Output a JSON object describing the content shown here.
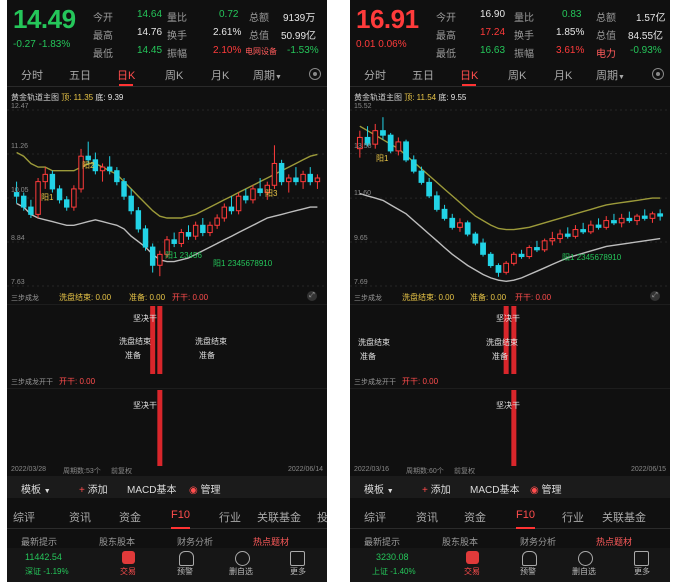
{
  "left": {
    "price": "14.49",
    "change": "-0.27",
    "change_pct": "-1.83%",
    "color_price": "#25c65a",
    "quote": [
      {
        "label": "今开",
        "value": "14.64",
        "label2": "量比",
        "value2": "0.72",
        "label3": "总额",
        "value3": "9139万"
      },
      {
        "label": "最高",
        "value": "14.76",
        "label2": "换手",
        "value2": "2.61%",
        "label3": "总值",
        "value3": "50.99亿"
      },
      {
        "label": "最低",
        "value": "14.45",
        "label2": "振幅",
        "value2": "2.10%",
        "label3": "电网设备",
        "value3": "-1.53%"
      }
    ],
    "period_tabs": [
      "分时",
      "五日",
      "日K",
      "周K",
      "月K",
      "周期"
    ],
    "active_tab": "日K",
    "indicator_name": "黄金轨道主图",
    "indicator_top": "顶: 11.35",
    "indicator_bottom": "底: 9.39",
    "y_ticks": [
      "12.47",
      "11.26",
      "10.05",
      "8.84",
      "7.63"
    ],
    "signal_labels": [
      "阳1",
      "阳2",
      "阳3",
      "阳1 23456",
      "阳1 2345678910"
    ],
    "sub1_title": "三步成龙",
    "sub1_items": [
      "洗盘结束: 0.00",
      "准备: 0.00",
      "开干: 0.00"
    ],
    "sub1_signals": [
      "坚决干",
      "洗盘结束",
      "准备",
      "洗盘结束",
      "准备"
    ],
    "sub2_title": "三步成龙开干",
    "sub2_items": [
      "开干: 0.00"
    ],
    "sub2_signals": [
      "坚决干"
    ],
    "date_start": "2022/03/28",
    "period_count": "周期数:53个",
    "adjust": "前复权",
    "date_end": "2022/06/14",
    "bottom_tools": [
      "模板",
      "添加",
      "MACD基本",
      "管理"
    ],
    "info_tabs": [
      "综评",
      "资讯",
      "资金",
      "F10",
      "行业",
      "关联基金",
      "投"
    ],
    "active_info_tab": "F10",
    "peek_items": [
      "最新提示",
      "股东股本",
      "财务分析",
      "热点题材"
    ],
    "index_value": "11442.54",
    "index_name": "深证",
    "index_pct": "-1.19%",
    "nav_items": [
      "交易",
      "预警",
      "删自选",
      "更多"
    ]
  },
  "right": {
    "price": "16.91",
    "change": "0.01",
    "change_pct": "0.06%",
    "color_price": "#ff3b3b",
    "quote": [
      {
        "label": "今开",
        "value": "16.90",
        "label2": "量比",
        "value2": "0.83",
        "label3": "总额",
        "value3": "1.57亿"
      },
      {
        "label": "最高",
        "value": "17.24",
        "label2": "换手",
        "value2": "1.85%",
        "label3": "总值",
        "value3": "84.55亿"
      },
      {
        "label": "最低",
        "value": "16.63",
        "label2": "振幅",
        "value2": "3.61%",
        "label3": "电力",
        "value3": "-0.93%"
      }
    ],
    "period_tabs": [
      "分时",
      "五日",
      "日K",
      "周K",
      "月K",
      "周期"
    ],
    "active_tab": "日K",
    "indicator_name": "黄金轨道主图",
    "indicator_top": "顶: 11.54",
    "indicator_bottom": "底: 9.55",
    "y_ticks": [
      "15.52",
      "13.58",
      "11.60",
      "9.65",
      "7.69"
    ],
    "signal_labels": [
      "阳1",
      "阳1 2345678910"
    ],
    "sub1_title": "三步成龙",
    "sub1_items": [
      "洗盘结束: 0.00",
      "准备: 0.00",
      "开干: 0.00"
    ],
    "sub1_signals": [
      "坚决干",
      "洗盘结束",
      "准备",
      "洗盘结束",
      "准备"
    ],
    "sub2_title": "三步成龙开干",
    "sub2_items": [
      "开干: 0.00"
    ],
    "sub2_signals": [
      "坚决干"
    ],
    "date_start": "2022/03/16",
    "period_count": "周期数:60个",
    "adjust": "前复权",
    "date_end": "2022/06/15",
    "bottom_tools": [
      "模板",
      "添加",
      "MACD基本",
      "管理"
    ],
    "info_tabs": [
      "综评",
      "资讯",
      "资金",
      "F10",
      "行业",
      "关联基金"
    ],
    "active_info_tab": "F10",
    "peek_items": [
      "最新提示",
      "股东股本",
      "财务分析",
      "热点题材"
    ],
    "index_value": "3230.08",
    "index_name": "上证",
    "index_pct": "-1.40%",
    "nav_items": [
      "交易",
      "预警",
      "删自选",
      "更多"
    ]
  },
  "chart_data": [
    {
      "type": "candlestick",
      "panel": "left",
      "ylim": [
        7.63,
        12.47
      ],
      "y_ticks": [
        12.47,
        11.26,
        10.05,
        8.84,
        7.63
      ],
      "candles": [
        [
          10.2,
          10.5,
          9.9,
          10.1
        ],
        [
          10.1,
          10.2,
          9.7,
          9.8
        ],
        [
          9.8,
          10.0,
          9.5,
          9.6
        ],
        [
          9.6,
          10.6,
          9.5,
          10.5
        ],
        [
          10.5,
          10.9,
          10.3,
          10.7
        ],
        [
          10.7,
          10.8,
          10.2,
          10.3
        ],
        [
          10.3,
          10.4,
          9.9,
          10.0
        ],
        [
          10.0,
          10.1,
          9.7,
          9.8
        ],
        [
          9.8,
          10.4,
          9.7,
          10.3
        ],
        [
          10.3,
          11.4,
          10.2,
          11.2
        ],
        [
          11.2,
          11.6,
          11.0,
          11.1
        ],
        [
          11.1,
          11.3,
          10.7,
          10.8
        ],
        [
          10.8,
          11.0,
          10.5,
          10.9
        ],
        [
          10.9,
          11.2,
          10.7,
          10.8
        ],
        [
          10.8,
          10.9,
          10.4,
          10.5
        ],
        [
          10.5,
          10.6,
          10.0,
          10.1
        ],
        [
          10.1,
          10.3,
          9.6,
          9.7
        ],
        [
          9.7,
          9.8,
          9.1,
          9.2
        ],
        [
          9.2,
          9.3,
          8.6,
          8.7
        ],
        [
          8.7,
          8.8,
          8.0,
          8.2
        ],
        [
          8.2,
          8.6,
          7.9,
          8.5
        ],
        [
          8.5,
          9.0,
          8.4,
          8.9
        ],
        [
          8.9,
          9.1,
          8.7,
          8.8
        ],
        [
          8.8,
          9.2,
          8.7,
          9.1
        ],
        [
          9.1,
          9.3,
          8.9,
          9.0
        ],
        [
          9.0,
          9.4,
          8.9,
          9.3
        ],
        [
          9.3,
          9.5,
          9.0,
          9.1
        ],
        [
          9.1,
          9.4,
          9.0,
          9.3
        ],
        [
          9.3,
          9.6,
          9.2,
          9.5
        ],
        [
          9.5,
          9.9,
          9.4,
          9.8
        ],
        [
          9.8,
          10.1,
          9.6,
          9.7
        ],
        [
          9.7,
          10.2,
          9.6,
          10.1
        ],
        [
          10.1,
          10.3,
          9.9,
          10.0
        ],
        [
          10.0,
          10.4,
          9.9,
          10.3
        ],
        [
          10.3,
          10.6,
          10.1,
          10.2
        ],
        [
          10.2,
          10.5,
          10.0,
          10.4
        ],
        [
          10.4,
          11.5,
          10.3,
          11.0
        ],
        [
          11.0,
          11.1,
          10.4,
          10.5
        ],
        [
          10.5,
          10.7,
          10.2,
          10.6
        ],
        [
          10.6,
          10.9,
          10.4,
          10.5
        ],
        [
          10.5,
          10.8,
          10.3,
          10.7
        ],
        [
          10.7,
          10.9,
          10.4,
          10.5
        ],
        [
          10.5,
          10.7,
          10.3,
          10.6
        ]
      ],
      "upper_band": [
        11.3,
        11.2,
        11.0,
        10.9,
        10.9,
        10.8,
        10.8,
        10.8,
        10.8,
        10.9,
        11.0,
        11.0,
        10.9,
        10.8,
        10.7,
        10.5,
        10.3,
        10.1,
        9.9,
        9.7,
        9.55,
        9.5,
        9.5,
        9.5,
        9.55,
        9.6,
        9.7,
        9.8,
        9.9,
        10.0,
        10.1,
        10.2,
        10.3,
        10.4,
        10.5,
        10.6,
        10.7,
        10.8,
        10.9,
        11.0,
        11.1,
        11.2,
        11.25
      ],
      "lower_band": [
        9.9,
        9.8,
        9.6,
        9.5,
        9.45,
        9.4,
        9.35,
        9.3,
        9.3,
        9.35,
        9.4,
        9.45,
        9.4,
        9.35,
        9.3,
        9.2,
        9.0,
        8.85,
        8.7,
        8.5,
        8.35,
        8.3,
        8.3,
        8.35,
        8.4,
        8.5,
        8.6,
        8.7,
        8.8,
        8.9,
        9.0,
        9.1,
        9.2,
        9.3,
        9.4,
        9.5,
        9.55,
        9.6,
        9.65,
        9.7,
        9.75,
        9.8,
        9.8
      ],
      "sub1_bars": [
        0,
        0,
        0,
        0,
        0,
        0,
        0,
        0,
        0,
        0,
        0,
        0,
        0,
        0,
        0,
        0,
        0,
        0,
        0,
        1,
        1,
        0,
        0,
        0,
        0,
        0,
        0,
        0,
        0,
        0,
        0,
        0,
        0,
        0,
        0,
        0,
        0,
        0,
        0,
        0,
        0,
        0,
        0
      ],
      "sub2_bars": [
        0,
        0,
        0,
        0,
        0,
        0,
        0,
        0,
        0,
        0,
        0,
        0,
        0,
        0,
        0,
        0,
        0,
        0,
        0,
        0,
        1,
        0,
        0,
        0,
        0,
        0,
        0,
        0,
        0,
        0,
        0,
        0,
        0,
        0,
        0,
        0,
        0,
        0,
        0,
        0,
        0,
        0,
        0
      ]
    },
    {
      "type": "candlestick",
      "panel": "right",
      "ylim": [
        7.69,
        15.52
      ],
      "y_ticks": [
        15.52,
        13.58,
        11.6,
        9.65,
        7.69
      ],
      "candles": [
        [
          13.8,
          14.6,
          13.4,
          14.3
        ],
        [
          14.3,
          14.8,
          13.9,
          14.0
        ],
        [
          14.0,
          14.9,
          13.8,
          14.6
        ],
        [
          14.6,
          15.2,
          14.2,
          14.4
        ],
        [
          14.4,
          14.5,
          13.6,
          13.7
        ],
        [
          13.7,
          14.3,
          13.5,
          14.1
        ],
        [
          14.1,
          14.2,
          13.2,
          13.3
        ],
        [
          13.3,
          13.5,
          12.7,
          12.8
        ],
        [
          12.8,
          13.0,
          12.2,
          12.3
        ],
        [
          12.3,
          12.5,
          11.6,
          11.7
        ],
        [
          11.7,
          11.9,
          11.0,
          11.1
        ],
        [
          11.1,
          11.3,
          10.6,
          10.7
        ],
        [
          10.7,
          10.9,
          10.2,
          10.3
        ],
        [
          10.3,
          10.7,
          10.1,
          10.5
        ],
        [
          10.5,
          10.6,
          9.9,
          10.0
        ],
        [
          10.0,
          10.1,
          9.5,
          9.6
        ],
        [
          9.6,
          9.8,
          9.0,
          9.1
        ],
        [
          9.1,
          9.2,
          8.5,
          8.6
        ],
        [
          8.6,
          8.7,
          8.1,
          8.3
        ],
        [
          8.3,
          8.8,
          8.2,
          8.7
        ],
        [
          8.7,
          9.2,
          8.6,
          9.1
        ],
        [
          9.1,
          9.3,
          8.9,
          9.0
        ],
        [
          9.0,
          9.5,
          8.9,
          9.4
        ],
        [
          9.4,
          9.7,
          9.2,
          9.3
        ],
        [
          9.3,
          9.8,
          9.2,
          9.7
        ],
        [
          9.7,
          10.1,
          9.5,
          9.8
        ],
        [
          9.8,
          10.2,
          9.6,
          10.0
        ],
        [
          10.0,
          10.3,
          9.8,
          9.9
        ],
        [
          9.9,
          10.4,
          9.8,
          10.2
        ],
        [
          10.2,
          10.5,
          10.0,
          10.1
        ],
        [
          10.1,
          10.6,
          10.0,
          10.4
        ],
        [
          10.4,
          10.7,
          10.2,
          10.3
        ],
        [
          10.3,
          10.8,
          10.2,
          10.6
        ],
        [
          10.6,
          10.9,
          10.4,
          10.5
        ],
        [
          10.5,
          10.9,
          10.3,
          10.7
        ],
        [
          10.7,
          11.0,
          10.5,
          10.6
        ],
        [
          10.6,
          10.9,
          10.4,
          10.8
        ],
        [
          10.8,
          11.1,
          10.6,
          10.7
        ],
        [
          10.7,
          11.0,
          10.5,
          10.9
        ],
        [
          10.9,
          11.1,
          10.6,
          10.8
        ]
      ],
      "upper_band": [
        14.8,
        14.6,
        14.4,
        14.2,
        14.0,
        13.8,
        13.5,
        13.2,
        12.9,
        12.6,
        12.3,
        12.0,
        11.7,
        11.4,
        11.1,
        10.8,
        10.6,
        10.4,
        10.25,
        10.2,
        10.2,
        10.25,
        10.3,
        10.4,
        10.5,
        10.6,
        10.7,
        10.8,
        10.9,
        11.0,
        11.1,
        11.2,
        11.3,
        11.35,
        11.4,
        11.45,
        11.5,
        11.55,
        11.6,
        11.6
      ],
      "lower_band": [
        11.8,
        11.7,
        11.6,
        11.5,
        11.3,
        11.1,
        10.9,
        10.6,
        10.3,
        10.0,
        9.7,
        9.4,
        9.1,
        8.85,
        8.6,
        8.4,
        8.2,
        8.05,
        7.95,
        7.9,
        7.95,
        8.05,
        8.2,
        8.35,
        8.5,
        8.65,
        8.8,
        8.95,
        9.05,
        9.15,
        9.25,
        9.35,
        9.45,
        9.5,
        9.55,
        9.6,
        9.65,
        9.7,
        9.75,
        9.8
      ],
      "sub1_bars": [
        0,
        0,
        0,
        0,
        0,
        0,
        0,
        0,
        0,
        0,
        0,
        0,
        0,
        0,
        0,
        0,
        0,
        0,
        0,
        1,
        1,
        0,
        0,
        0,
        0,
        0,
        0,
        0,
        0,
        0,
        0,
        0,
        0,
        0,
        0,
        0,
        0,
        0,
        0,
        0
      ],
      "sub2_bars": [
        0,
        0,
        0,
        0,
        0,
        0,
        0,
        0,
        0,
        0,
        0,
        0,
        0,
        0,
        0,
        0,
        0,
        0,
        0,
        0,
        1,
        0,
        0,
        0,
        0,
        0,
        0,
        0,
        0,
        0,
        0,
        0,
        0,
        0,
        0,
        0,
        0,
        0,
        0,
        0
      ]
    }
  ],
  "colors": {
    "up": "#ff3b3b",
    "down": "#22d3e6",
    "green": "#25c65a",
    "upper_band": "#9c9a3a",
    "lower_band": "#bdbdbd",
    "yellow": "#e8c547"
  }
}
